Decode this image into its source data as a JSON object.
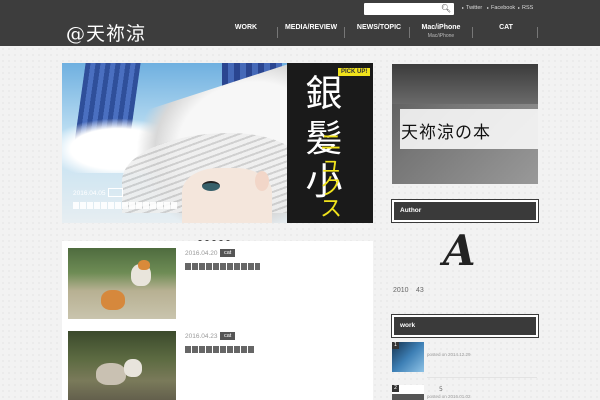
{
  "site": {
    "logo": "@天祢涼"
  },
  "search": {
    "placeholder": ""
  },
  "social": [
    {
      "label": "Twitter"
    },
    {
      "label": "Facebook"
    },
    {
      "label": "RSS"
    }
  ],
  "nav": [
    {
      "label": "WORK",
      "sub": ""
    },
    {
      "label": "MEDIA/REVIEW",
      "sub": ""
    },
    {
      "label": "NEWS/TOPIC",
      "sub": ""
    },
    {
      "label": "Mac/iPhone",
      "sub": "Mac/iPhone"
    },
    {
      "label": "CAT",
      "sub": ""
    }
  ],
  "slider": {
    "badge": "PICK UP!",
    "kanji_top": "銀",
    "kanji_mid": "髪",
    "kanji_low": "小",
    "kanji_yel1": "ニ",
    "kanji_yel2": "ュ",
    "kanji_yel3": "ク",
    "kanji_yel4": "ス",
    "date": "2016.04.05",
    "dots": 5
  },
  "articles": [
    {
      "date": "2016.04.20",
      "category": "cat"
    },
    {
      "date": "2016.04.23",
      "category": "cat"
    }
  ],
  "sidebar": {
    "book_banner": "天祢涼の本",
    "author_heading": "Author",
    "monogram": "A",
    "stats": [
      "2010",
      "43"
    ],
    "work_heading": "work",
    "work_items": [
      {
        "badge": "1",
        "meta": "posted on 2014.12.29"
      },
      {
        "badge": "2",
        "num": "5",
        "meta": "posted on 2016.01.02"
      }
    ]
  },
  "colors": {
    "header_bg": "#3d3d3d",
    "accent_yellow": "#f1e31c",
    "widget_bg": "#3a3a3a"
  }
}
